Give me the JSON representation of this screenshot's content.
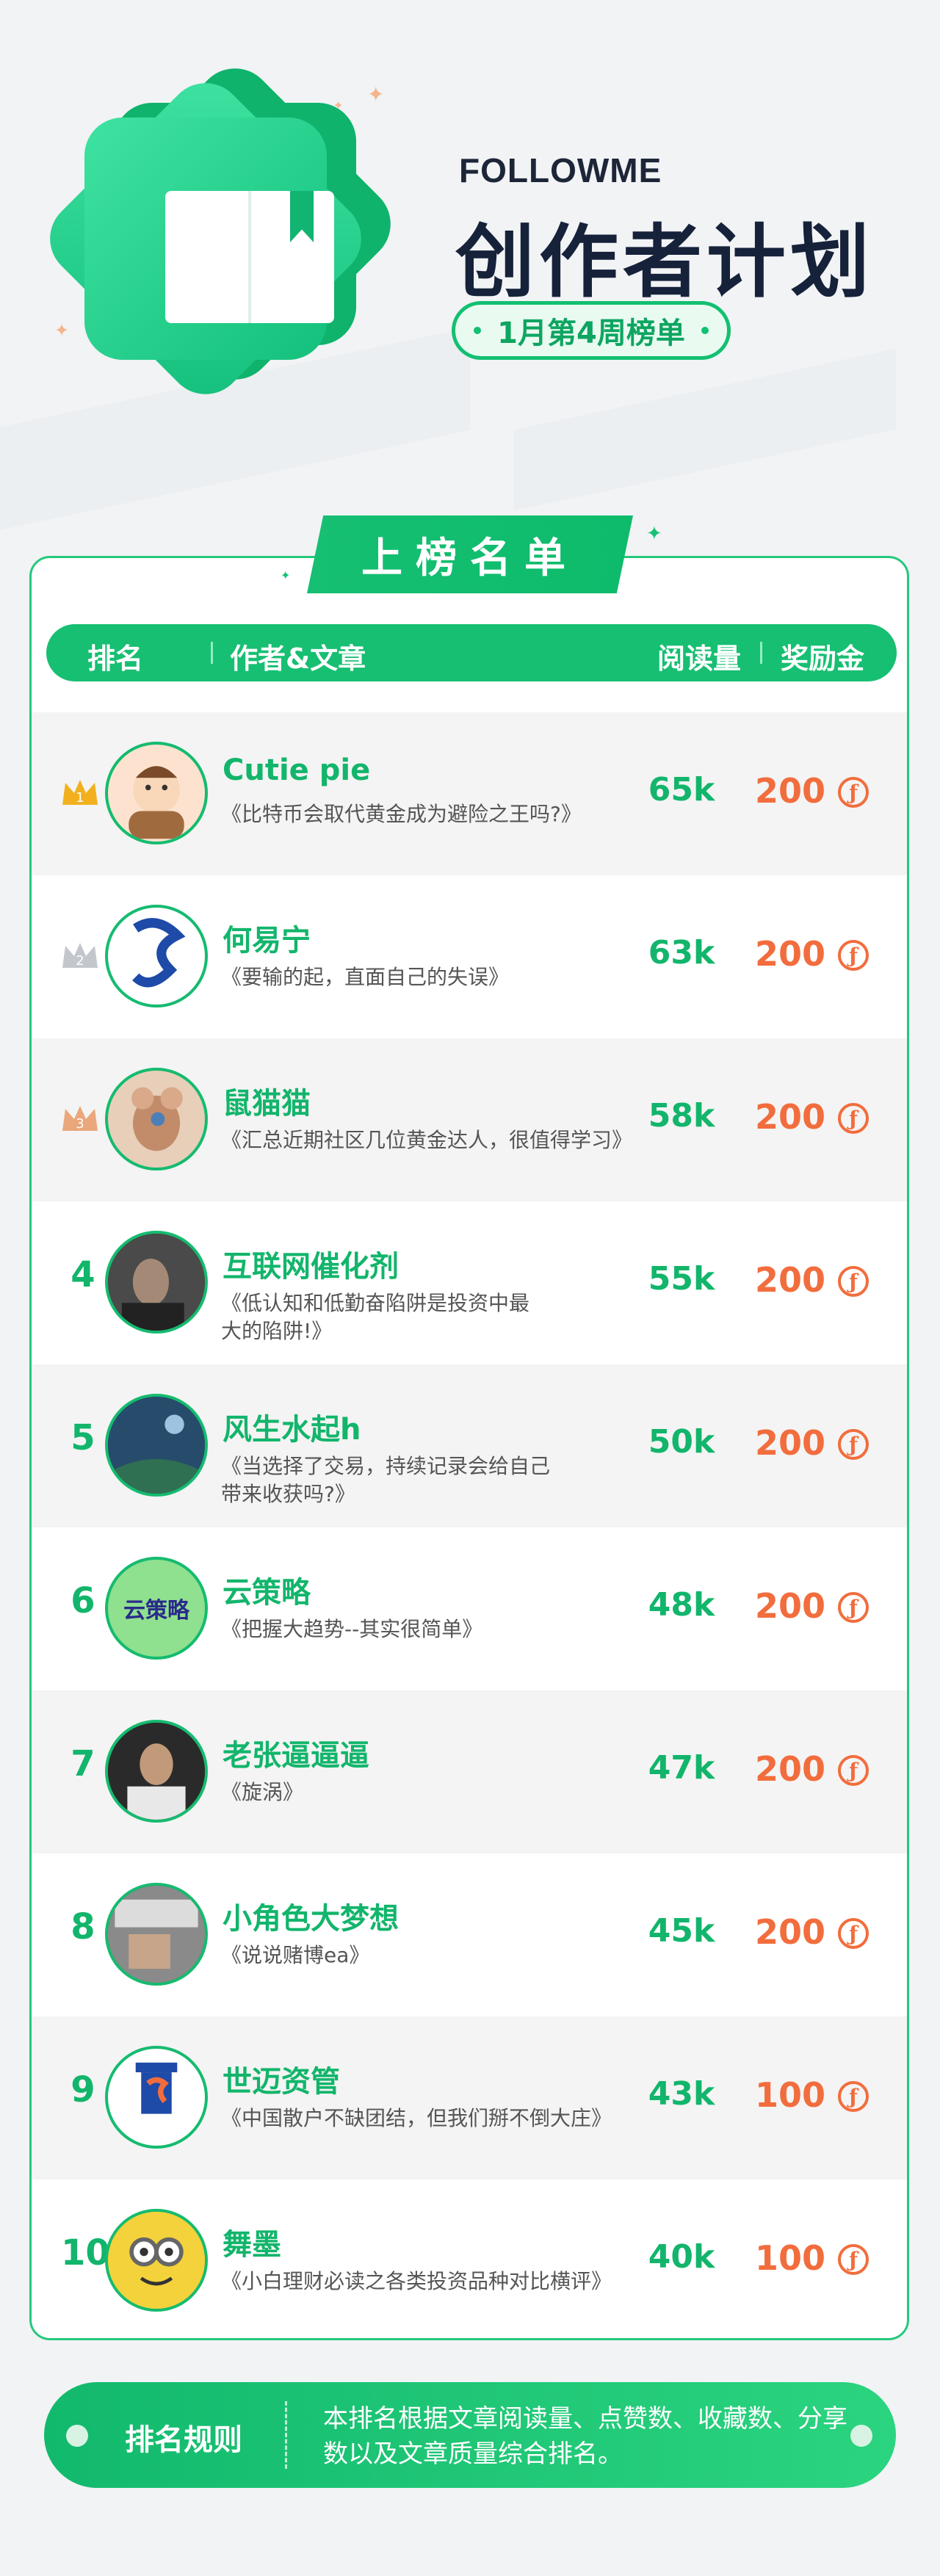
{
  "brand": {
    "name": "FOLLOWME"
  },
  "title": "创作者计划",
  "subtitle": "1月第4周榜单",
  "section_title": "上榜名单",
  "table": {
    "headers": {
      "rank": "排名",
      "author_article": "作者&文章",
      "reads": "阅读量",
      "bonus": "奖励金"
    },
    "rows": [
      {
        "rank": "1",
        "author": "Cutie pie",
        "article": "《比特币会取代黄金成为避险之王吗?》",
        "reads": "65k",
        "bonus": "200",
        "medal": "gold"
      },
      {
        "rank": "2",
        "author": "何易宁",
        "article": "《要输的起，直面自己的失误》",
        "reads": "63k",
        "bonus": "200",
        "medal": "silver"
      },
      {
        "rank": "3",
        "author": "鼠猫猫",
        "article": "《汇总近期社区几位黄金达人，很值得学习》",
        "reads": "58k",
        "bonus": "200",
        "medal": "bronze"
      },
      {
        "rank": "4",
        "author": "互联网催化剂",
        "article": "《低认知和低勤奋陷阱是投资中最大的陷阱!》",
        "reads": "55k",
        "bonus": "200"
      },
      {
        "rank": "5",
        "author": "风生水起h",
        "article": "《当选择了交易，持续记录会给自己带来收获吗?》",
        "reads": "50k",
        "bonus": "200"
      },
      {
        "rank": "6",
        "author": "云策略",
        "article": "《把握大趋势--其实很简单》",
        "reads": "48k",
        "bonus": "200",
        "avatar_text": "云策略"
      },
      {
        "rank": "7",
        "author": "老张逼逼逼",
        "article": "《旋涡》",
        "reads": "47k",
        "bonus": "200"
      },
      {
        "rank": "8",
        "author": "小角色大梦想",
        "article": "《说说赌博ea》",
        "reads": "45k",
        "bonus": "200"
      },
      {
        "rank": "9",
        "author": "世迈资管",
        "article": "《中国散户不缺团结，但我们掰不倒大庄》",
        "reads": "43k",
        "bonus": "100"
      },
      {
        "rank": "10",
        "author": "舞墨",
        "article": "《小白理财必读之各类投资品种对比横评》",
        "reads": "40k",
        "bonus": "100"
      }
    ]
  },
  "footer": {
    "title": "排名规则",
    "text": "本排名根据文章阅读量、点赞数、收藏数、分享数以及文章质量综合排名。"
  },
  "colors": {
    "accent": "#16bf72",
    "bonus": "#f26d3d",
    "title": "#16213a"
  }
}
